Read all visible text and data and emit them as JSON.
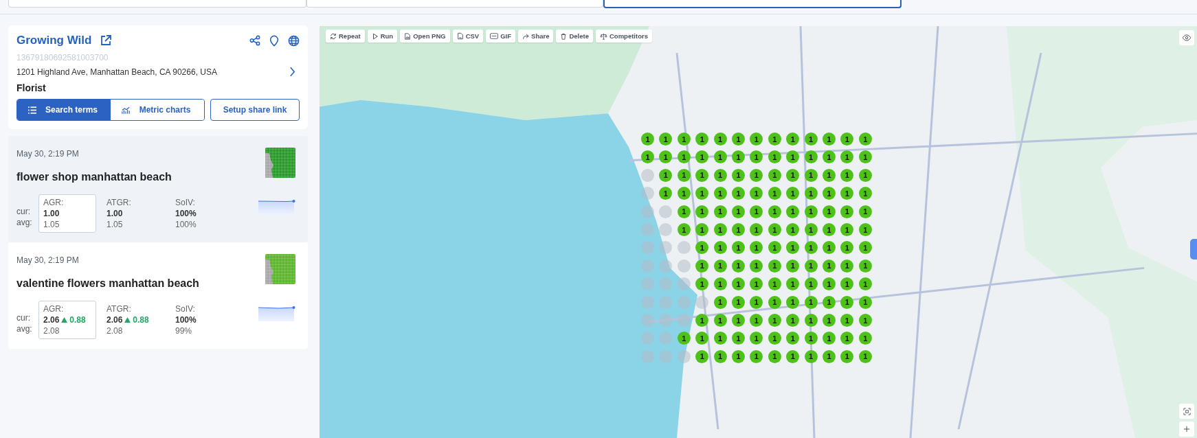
{
  "business": {
    "name": "Growing Wild",
    "id": "13679180692581003700",
    "address": "1201 Highland Ave, Manhattan Beach, CA 90266, USA",
    "category": "Florist"
  },
  "view_tabs": [
    {
      "label": "Search terms",
      "selected": true,
      "kind": "list"
    },
    {
      "label": "Metric charts",
      "selected": false,
      "kind": "chart"
    }
  ],
  "share_button": "Setup share link",
  "terms": [
    {
      "date": "May 30, 2:19 PM",
      "title": "flower shop manhattan beach",
      "selected": true,
      "cur_label": "cur:",
      "avg_label": "avg:",
      "metrics": [
        {
          "label": "AGR:",
          "cur": "1.00",
          "avg": "1.05",
          "selected": true
        },
        {
          "label": "ATGR:",
          "cur": "1.00",
          "avg": "1.05",
          "selected": false
        },
        {
          "label": "SoIV:",
          "cur": "100%",
          "avg": "100%",
          "selected": false
        }
      ]
    },
    {
      "date": "May 30, 2:19 PM",
      "title": "valentine flowers manhattan beach",
      "selected": false,
      "cur_label": "cur:",
      "avg_label": "avg:",
      "metrics": [
        {
          "label": "AGR:",
          "cur": "2.06",
          "delta": "0.88",
          "avg": "2.08",
          "selected": true
        },
        {
          "label": "ATGR:",
          "cur": "2.06",
          "delta": "0.88",
          "avg": "2.08",
          "selected": false
        },
        {
          "label": "SoIV:",
          "cur": "100%",
          "avg": "99%",
          "selected": false
        }
      ]
    }
  ],
  "toolbar": [
    {
      "label": "Repeat",
      "kind": "repeat"
    },
    {
      "label": "Run",
      "kind": "run"
    },
    {
      "label": "Open PNG",
      "kind": "png"
    },
    {
      "label": "CSV",
      "kind": "csv"
    },
    {
      "label": "GIF",
      "kind": "gif"
    },
    {
      "label": "Share",
      "kind": "share"
    },
    {
      "label": "Delete",
      "kind": "delete"
    },
    {
      "label": "Competitors",
      "kind": "competitors"
    }
  ],
  "grid": [
    {
      "pins": [
        {
          "found": true,
          "rank": "1"
        },
        {
          "found": true,
          "rank": "1"
        },
        {
          "found": true,
          "rank": "1"
        },
        {
          "found": true,
          "rank": "1"
        },
        {
          "found": true,
          "rank": "1"
        },
        {
          "found": true,
          "rank": "1"
        },
        {
          "found": true,
          "rank": "1"
        },
        {
          "found": true,
          "rank": "1"
        },
        {
          "found": true,
          "rank": "1"
        },
        {
          "found": true,
          "rank": "1"
        },
        {
          "found": true,
          "rank": "1"
        },
        {
          "found": true,
          "rank": "1"
        },
        {
          "found": true,
          "rank": "1"
        }
      ]
    },
    {
      "pins": [
        {
          "found": true,
          "rank": "1"
        },
        {
          "found": true,
          "rank": "1"
        },
        {
          "found": true,
          "rank": "1"
        },
        {
          "found": true,
          "rank": "1"
        },
        {
          "found": true,
          "rank": "1"
        },
        {
          "found": true,
          "rank": "1"
        },
        {
          "found": true,
          "rank": "1"
        },
        {
          "found": true,
          "rank": "1"
        },
        {
          "found": true,
          "rank": "1"
        },
        {
          "found": true,
          "rank": "1"
        },
        {
          "found": true,
          "rank": "1"
        },
        {
          "found": true,
          "rank": "1"
        },
        {
          "found": true,
          "rank": "1"
        }
      ]
    },
    {
      "pins": [
        {
          "found": false
        },
        {
          "found": true,
          "rank": "1"
        },
        {
          "found": true,
          "rank": "1"
        },
        {
          "found": true,
          "rank": "1"
        },
        {
          "found": true,
          "rank": "1"
        },
        {
          "found": true,
          "rank": "1"
        },
        {
          "found": true,
          "rank": "1"
        },
        {
          "found": true,
          "rank": "1"
        },
        {
          "found": true,
          "rank": "1"
        },
        {
          "found": true,
          "rank": "1"
        },
        {
          "found": true,
          "rank": "1"
        },
        {
          "found": true,
          "rank": "1"
        },
        {
          "found": true,
          "rank": "1"
        }
      ]
    },
    {
      "pins": [
        {
          "found": false
        },
        {
          "found": true,
          "rank": "1"
        },
        {
          "found": true,
          "rank": "1"
        },
        {
          "found": true,
          "rank": "1"
        },
        {
          "found": true,
          "rank": "1"
        },
        {
          "found": true,
          "rank": "1"
        },
        {
          "found": true,
          "rank": "1"
        },
        {
          "found": true,
          "rank": "1"
        },
        {
          "found": true,
          "rank": "1"
        },
        {
          "found": true,
          "rank": "1"
        },
        {
          "found": true,
          "rank": "1"
        },
        {
          "found": true,
          "rank": "1"
        },
        {
          "found": true,
          "rank": "1"
        }
      ]
    },
    {
      "pins": [
        {
          "found": false
        },
        {
          "found": false
        },
        {
          "found": true,
          "rank": "1"
        },
        {
          "found": true,
          "rank": "1"
        },
        {
          "found": true,
          "rank": "1"
        },
        {
          "found": true,
          "rank": "1"
        },
        {
          "found": true,
          "rank": "1"
        },
        {
          "found": true,
          "rank": "1"
        },
        {
          "found": true,
          "rank": "1"
        },
        {
          "found": true,
          "rank": "1"
        },
        {
          "found": true,
          "rank": "1"
        },
        {
          "found": true,
          "rank": "1"
        },
        {
          "found": true,
          "rank": "1"
        }
      ]
    },
    {
      "pins": [
        {
          "found": false
        },
        {
          "found": false
        },
        {
          "found": true,
          "rank": "1"
        },
        {
          "found": true,
          "rank": "1"
        },
        {
          "found": true,
          "rank": "1"
        },
        {
          "found": true,
          "rank": "1"
        },
        {
          "found": true,
          "rank": "1"
        },
        {
          "found": true,
          "rank": "1"
        },
        {
          "found": true,
          "rank": "1"
        },
        {
          "found": true,
          "rank": "1"
        },
        {
          "found": true,
          "rank": "1"
        },
        {
          "found": true,
          "rank": "1"
        },
        {
          "found": true,
          "rank": "1"
        }
      ]
    },
    {
      "pins": [
        {
          "found": false
        },
        {
          "found": false
        },
        {
          "found": false
        },
        {
          "found": true,
          "rank": "1"
        },
        {
          "found": true,
          "rank": "1"
        },
        {
          "found": true,
          "rank": "1"
        },
        {
          "found": true,
          "rank": "1"
        },
        {
          "found": true,
          "rank": "1"
        },
        {
          "found": true,
          "rank": "1"
        },
        {
          "found": true,
          "rank": "1"
        },
        {
          "found": true,
          "rank": "1"
        },
        {
          "found": true,
          "rank": "1"
        },
        {
          "found": true,
          "rank": "1"
        }
      ]
    },
    {
      "pins": [
        {
          "found": false
        },
        {
          "found": false
        },
        {
          "found": false
        },
        {
          "found": true,
          "rank": "1"
        },
        {
          "found": true,
          "rank": "1"
        },
        {
          "found": true,
          "rank": "1"
        },
        {
          "found": true,
          "rank": "1"
        },
        {
          "found": true,
          "rank": "1"
        },
        {
          "found": true,
          "rank": "1"
        },
        {
          "found": true,
          "rank": "1"
        },
        {
          "found": true,
          "rank": "1"
        },
        {
          "found": true,
          "rank": "1"
        },
        {
          "found": true,
          "rank": "1"
        }
      ]
    },
    {
      "pins": [
        {
          "found": false
        },
        {
          "found": false
        },
        {
          "found": false
        },
        {
          "found": true,
          "rank": "1"
        },
        {
          "found": true,
          "rank": "1"
        },
        {
          "found": true,
          "rank": "1"
        },
        {
          "found": true,
          "rank": "1"
        },
        {
          "found": true,
          "rank": "1"
        },
        {
          "found": true,
          "rank": "1"
        },
        {
          "found": true,
          "rank": "1"
        },
        {
          "found": true,
          "rank": "1"
        },
        {
          "found": true,
          "rank": "1"
        },
        {
          "found": true,
          "rank": "1"
        }
      ]
    },
    {
      "pins": [
        {
          "found": false
        },
        {
          "found": false
        },
        {
          "found": false
        },
        {
          "found": false
        },
        {
          "found": true,
          "rank": "1"
        },
        {
          "found": true,
          "rank": "1"
        },
        {
          "found": true,
          "rank": "1"
        },
        {
          "found": true,
          "rank": "1"
        },
        {
          "found": true,
          "rank": "1"
        },
        {
          "found": true,
          "rank": "1"
        },
        {
          "found": true,
          "rank": "1"
        },
        {
          "found": true,
          "rank": "1"
        },
        {
          "found": true,
          "rank": "1"
        }
      ]
    },
    {
      "pins": [
        {
          "found": false
        },
        {
          "found": false
        },
        {
          "found": false
        },
        {
          "found": true,
          "rank": "1"
        },
        {
          "found": true,
          "rank": "1"
        },
        {
          "found": true,
          "rank": "1"
        },
        {
          "found": true,
          "rank": "1"
        },
        {
          "found": true,
          "rank": "1"
        },
        {
          "found": true,
          "rank": "1"
        },
        {
          "found": true,
          "rank": "1"
        },
        {
          "found": true,
          "rank": "1"
        },
        {
          "found": true,
          "rank": "1"
        },
        {
          "found": true,
          "rank": "1"
        }
      ]
    },
    {
      "pins": [
        {
          "found": false
        },
        {
          "found": false
        },
        {
          "found": true,
          "rank": "1"
        },
        {
          "found": true,
          "rank": "1"
        },
        {
          "found": true,
          "rank": "1"
        },
        {
          "found": true,
          "rank": "1"
        },
        {
          "found": true,
          "rank": "1"
        },
        {
          "found": true,
          "rank": "1"
        },
        {
          "found": true,
          "rank": "1"
        },
        {
          "found": true,
          "rank": "1"
        },
        {
          "found": true,
          "rank": "1"
        },
        {
          "found": true,
          "rank": "1"
        },
        {
          "found": true,
          "rank": "1"
        }
      ]
    },
    {
      "pins": [
        {
          "found": false
        },
        {
          "found": false
        },
        {
          "found": false
        },
        {
          "found": true,
          "rank": "1"
        },
        {
          "found": true,
          "rank": "1"
        },
        {
          "found": true,
          "rank": "1"
        },
        {
          "found": true,
          "rank": "1"
        },
        {
          "found": true,
          "rank": "1"
        },
        {
          "found": true,
          "rank": "1"
        },
        {
          "found": true,
          "rank": "1"
        },
        {
          "found": true,
          "rank": "1"
        },
        {
          "found": true,
          "rank": "1"
        },
        {
          "found": true,
          "rank": "1"
        }
      ]
    }
  ]
}
